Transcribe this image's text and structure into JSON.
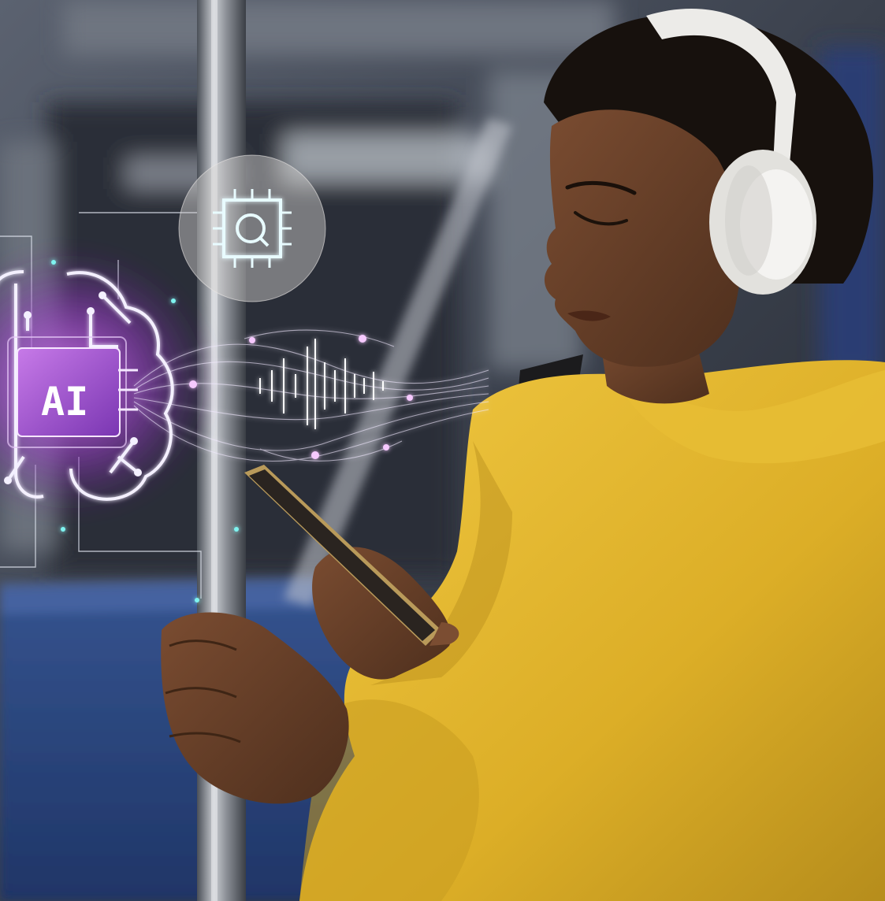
{
  "photo": {
    "chip_label": "AI",
    "colors": {
      "train_interior": "#3a4250",
      "seat_blue": "#2c4a86",
      "hoodie_yellow": "#e3b731",
      "skin": "#6b432c",
      "hair": "#17110d",
      "headphones": "#ecebe8",
      "ai_glow": "#b14bd6",
      "circuit_line": "#e9ecf3",
      "accent_cyan": "#7ff3f0"
    },
    "icons": [
      "brain-circuit-icon",
      "ai-chip-icon",
      "processor-search-icon",
      "sound-wave-icon"
    ]
  }
}
